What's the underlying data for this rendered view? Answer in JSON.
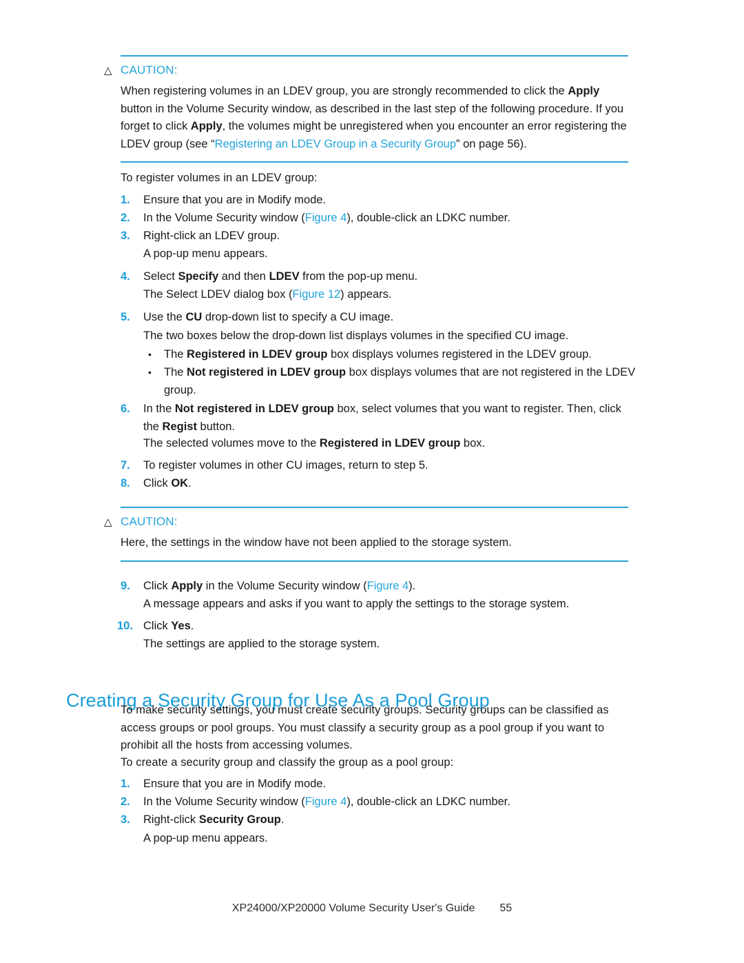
{
  "document": {
    "footer_title": "XP24000/XP20000 Volume Security User's Guide",
    "page_number": "55"
  },
  "colors": {
    "accent_blue": "#1a9dd9",
    "rule_blue": "#2ba2d6",
    "link_blue": "#22a3db",
    "body_text": "#1a1a1a",
    "page_background": "#ffffff"
  },
  "caution_1": {
    "icon": "warning-triangle-icon",
    "icon_glyph": "△",
    "label": "CAUTION:",
    "body_part_1": "When registering volumes in an LDEV group, you are strongly recommended to click the ",
    "body_bold_1": "Apply",
    "body_part_2": " button in the Volume Security window, as described in the last step of the following procedure. If you forget to click ",
    "body_bold_2": "Apply",
    "body_part_3": ", the volumes might be unregistered when you encounter an error registering the LDEV group (see “",
    "body_link": "Registering an LDEV Group in a Security Group",
    "body_part_4": "” on page 56)."
  },
  "intro_1": "To register volumes in an LDEV group:",
  "steps_1": [
    {
      "num": "1.",
      "parts": [
        {
          "t": "Ensure that you are in Modify mode.",
          "s": "n"
        }
      ]
    },
    {
      "num": "2.",
      "parts": [
        {
          "t": "In the Volume Security window (",
          "s": "n"
        },
        {
          "t": "Figure 4",
          "s": "l"
        },
        {
          "t": "), double-click an LDKC number.",
          "s": "n"
        }
      ]
    },
    {
      "num": "3.",
      "parts": [
        {
          "t": "Right-click an LDEV group.",
          "s": "n"
        }
      ]
    }
  ],
  "cont_1": "A pop-up menu appears.",
  "step_4": {
    "num": "4.",
    "parts": [
      {
        "t": "Select ",
        "s": "n"
      },
      {
        "t": "Specify",
        "s": "b"
      },
      {
        "t": " and then ",
        "s": "n"
      },
      {
        "t": "LDEV",
        "s": "b"
      },
      {
        "t": " from the pop-up menu.",
        "s": "n"
      }
    ]
  },
  "cont_2": {
    "parts": [
      {
        "t": "The Select LDEV dialog box (",
        "s": "n"
      },
      {
        "t": "Figure 12",
        "s": "l"
      },
      {
        "t": ") appears.",
        "s": "n"
      }
    ]
  },
  "step_5": {
    "num": "5.",
    "parts": [
      {
        "t": "Use the ",
        "s": "n"
      },
      {
        "t": "CU",
        "s": "b"
      },
      {
        "t": " drop-down list to specify a CU image.",
        "s": "n"
      }
    ]
  },
  "cont_3": "The two boxes below the drop-down list displays volumes in the specified CU image.",
  "bullets": [
    {
      "dot": "•",
      "parts": [
        {
          "t": "The ",
          "s": "n"
        },
        {
          "t": "Registered in LDEV group",
          "s": "b"
        },
        {
          "t": " box displays volumes registered in the LDEV group.",
          "s": "n"
        }
      ]
    },
    {
      "dot": "•",
      "parts": [
        {
          "t": "The ",
          "s": "n"
        },
        {
          "t": "Not registered in LDEV group",
          "s": "b"
        },
        {
          "t": " box displays volumes that are not registered in the LDEV group.",
          "s": "n"
        }
      ]
    }
  ],
  "step_6": {
    "num": "6.",
    "parts": [
      {
        "t": "In the ",
        "s": "n"
      },
      {
        "t": "Not registered in LDEV group",
        "s": "b"
      },
      {
        "t": " box, select volumes that you want to register. Then, click the ",
        "s": "n"
      },
      {
        "t": "Regist",
        "s": "b"
      },
      {
        "t": " button.",
        "s": "n"
      }
    ]
  },
  "cont_4": {
    "parts": [
      {
        "t": "The selected volumes move to the ",
        "s": "n"
      },
      {
        "t": "Registered in LDEV group",
        "s": "b"
      },
      {
        "t": " box.",
        "s": "n"
      }
    ]
  },
  "step_7": {
    "num": "7.",
    "parts": [
      {
        "t": "To register volumes in other CU images, return to step 5.",
        "s": "n"
      }
    ]
  },
  "step_8": {
    "num": "8.",
    "parts": [
      {
        "t": "Click ",
        "s": "n"
      },
      {
        "t": "OK",
        "s": "b"
      },
      {
        "t": ".",
        "s": "n"
      }
    ]
  },
  "caution_2": {
    "icon": "warning-triangle-icon",
    "icon_glyph": "△",
    "label": "CAUTION:",
    "body": "Here, the settings in the window have not been applied to the storage system."
  },
  "step_9": {
    "num": "9.",
    "parts": [
      {
        "t": "Click ",
        "s": "n"
      },
      {
        "t": "Apply",
        "s": "b"
      },
      {
        "t": " in the Volume Security window (",
        "s": "n"
      },
      {
        "t": "Figure 4",
        "s": "l"
      },
      {
        "t": ").",
        "s": "n"
      }
    ]
  },
  "cont_5": "A message appears and asks if you want to apply the settings to the storage system.",
  "step_10": {
    "num": "10.",
    "parts": [
      {
        "t": "Click ",
        "s": "n"
      },
      {
        "t": "Yes",
        "s": "b"
      },
      {
        "t": ".",
        "s": "n"
      }
    ]
  },
  "cont_6": "The settings are applied to the storage system.",
  "section_heading": "Creating a Security Group for Use As a Pool Group",
  "section_para_1": "To make security settings, you must create security groups. Security groups can be classified as access groups or pool groups. You must classify a security group as a pool group if you want to prohibit all the hosts from accessing volumes.",
  "intro_2": "To create a security group and classify the group as a pool group:",
  "steps_2": [
    {
      "num": "1.",
      "parts": [
        {
          "t": "Ensure that you are in Modify mode.",
          "s": "n"
        }
      ]
    },
    {
      "num": "2.",
      "parts": [
        {
          "t": "In the Volume Security window (",
          "s": "n"
        },
        {
          "t": "Figure 4",
          "s": "l"
        },
        {
          "t": "), double-click an LDKC number.",
          "s": "n"
        }
      ]
    },
    {
      "num": "3.",
      "parts": [
        {
          "t": "Right-click ",
          "s": "n"
        },
        {
          "t": "Security Group",
          "s": "b"
        },
        {
          "t": ".",
          "s": "n"
        }
      ]
    }
  ],
  "cont_7": "A pop-up menu appears."
}
